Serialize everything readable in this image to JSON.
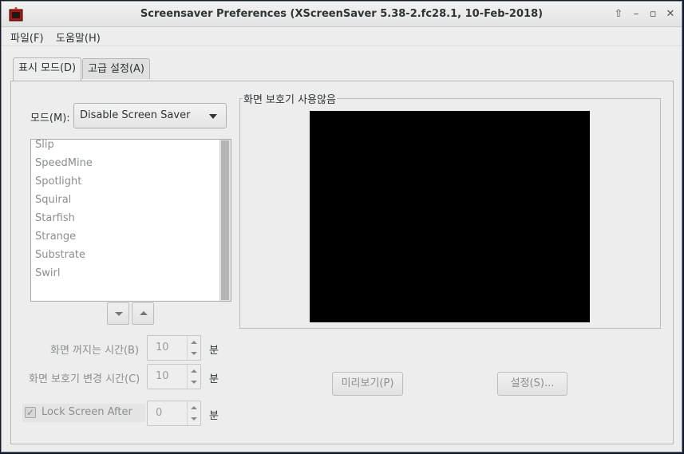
{
  "window": {
    "title": "Screensaver Preferences  (XScreenSaver 5.38-2.fc28.1, 10-Feb-2018)"
  },
  "menu": [
    "파일(F)",
    "도움말(H)"
  ],
  "tabs": [
    "표시 모드(D)",
    "고급 설정(A)"
  ],
  "mode": {
    "label": "모드(M):",
    "value": "Disable Screen Saver"
  },
  "screensaver_list": [
    "Slip",
    "SpeedMine",
    "Spotlight",
    "Squiral",
    "Starfish",
    "Strange",
    "Substrate",
    "Swirl"
  ],
  "preview": {
    "frame_title": "화면 보호기 사용않음",
    "preview_button": "미리보기(P)",
    "settings_button": "설정(S)..."
  },
  "blank_after": {
    "label": "화면 꺼지는 시간(B)",
    "value": "10",
    "unit": "분"
  },
  "cycle_after": {
    "label": "화면 보호기 변경 시간(C)",
    "value": "10",
    "unit": "분"
  },
  "lock_after": {
    "label": "Lock Screen After",
    "checked": true,
    "value": "0",
    "unit": "분"
  },
  "colors": {
    "preview_background": "#000000",
    "window_background": "#ededed"
  }
}
